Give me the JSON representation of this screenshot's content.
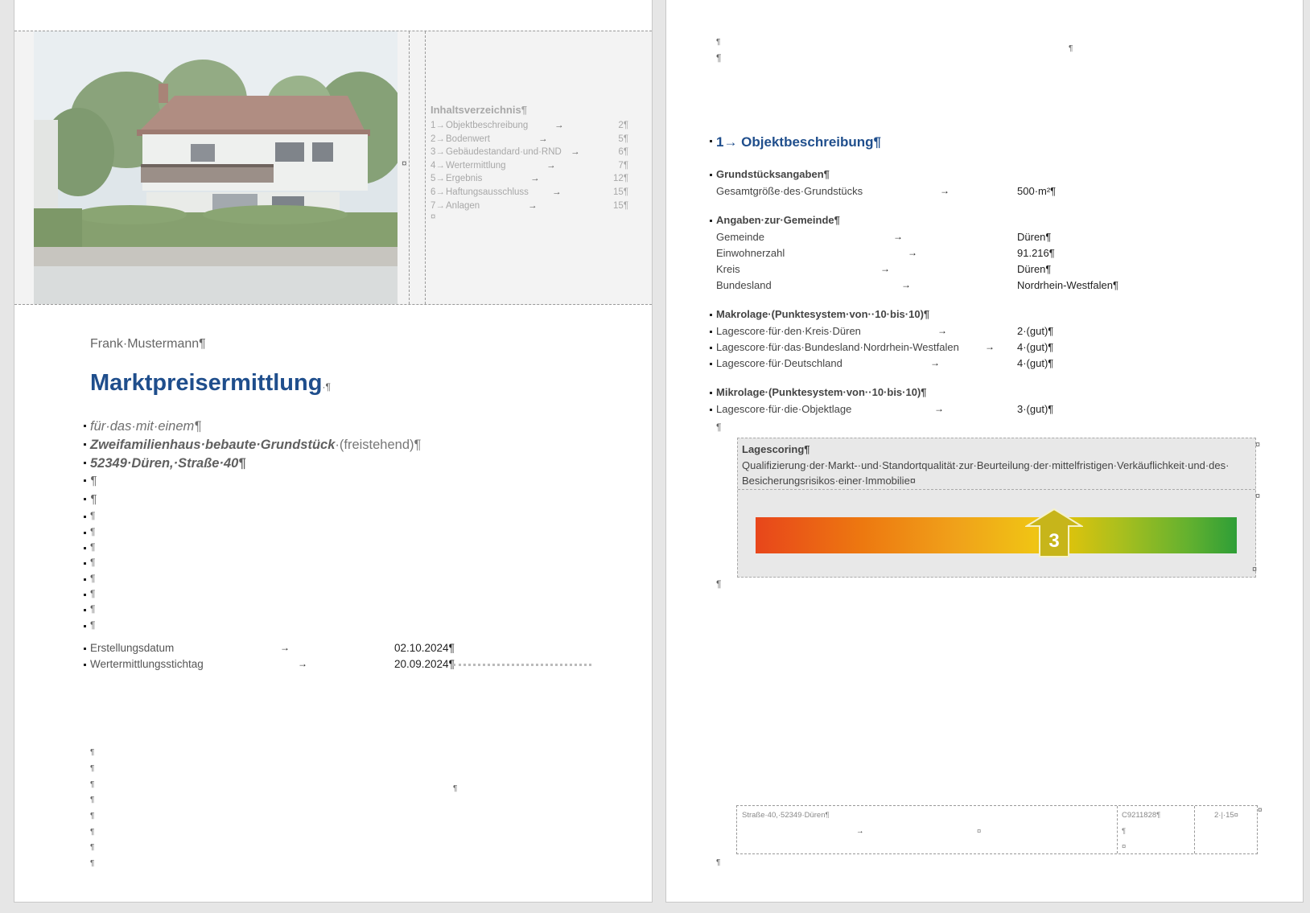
{
  "page1": {
    "toc": {
      "title": "Inhaltsverzeichnis¶",
      "items": [
        {
          "num": "1→",
          "label": "Objektbeschreibung",
          "page": "2¶"
        },
        {
          "num": "2→",
          "label": "Bodenwert",
          "page": "5¶"
        },
        {
          "num": "3→",
          "label": "Gebäudestandard·und·RND",
          "page": "6¶"
        },
        {
          "num": "4→",
          "label": "Wertermittlung",
          "page": "7¶"
        },
        {
          "num": "5→",
          "label": "Ergebnis",
          "page": "12¶"
        },
        {
          "num": "6→",
          "label": "Haftungsausschluss",
          "page": "15¶"
        },
        {
          "num": "7→",
          "label": "Anlagen",
          "page": "15¶"
        }
      ],
      "end_mark": "¤"
    },
    "author": "Frank·Mustermann¶",
    "title": "Marktpreisermittlung",
    "title_mark": "·¶",
    "subtitle_line1": "für·das·mit·einem¶",
    "subtitle_line2_bold": "Zweifamilienhaus·bebaute·Grundstück",
    "subtitle_line2_rest": "·(freistehend)¶",
    "address_line": "52349·Düren,·Straße·40¶",
    "pilcrow": "¶",
    "creation_label": "Erstellungsdatum",
    "creation_value": "02.10.2024¶",
    "valuation_label": "Wertermittlungsstichtag",
    "valuation_value": "20.09.2024¶",
    "tab_arrow": "→",
    "cell_mark": "¤"
  },
  "page2": {
    "heading": "1→ Objektbeschreibung¶",
    "grundstueck": {
      "title": "Grundstücksangaben¶",
      "rows": [
        {
          "label": "Gesamtgröße·des·Grundstücks",
          "value": "500·m²¶"
        }
      ]
    },
    "gemeinde": {
      "title": "Angaben·zur·Gemeinde¶",
      "rows": [
        {
          "label": "Gemeinde",
          "value": "Düren¶"
        },
        {
          "label": "Einwohnerzahl",
          "value": "91.216¶"
        },
        {
          "label": "Kreis",
          "value": "Düren¶"
        },
        {
          "label": "Bundesland",
          "value": "Nordrhein-Westfalen¶"
        }
      ]
    },
    "makrolage": {
      "title": "Makrolage·(Punktesystem·von··10·bis·10)¶",
      "rows": [
        {
          "label": "Lagescore·für·den·Kreis·Düren",
          "value": "2·(gut)¶"
        },
        {
          "label": "Lagescore·für·das·Bundesland·Nordrhein-Westfalen",
          "value": "4·(gut)¶"
        },
        {
          "label": "Lagescore·für·Deutschland",
          "value": "4·(gut)¶"
        }
      ]
    },
    "mikrolage": {
      "title": "Mikrolage·(Punktesystem·von··10·bis·10)¶",
      "rows": [
        {
          "label": "Lagescore·für·die·Objektlage",
          "value": "3·(gut)¶"
        }
      ]
    },
    "scoring": {
      "title": "Lagescoring¶",
      "desc_line1": "Qualifizierung·der·Markt-·und·Standortqualität·zur·Beurteilung·der·mittelfristigen·Verkäuflichkeit·und·des·",
      "desc_line2": "Besicherungsrisikos·einer·Immobilie¤",
      "score": "3",
      "score_fraction": 0.62
    },
    "footer": {
      "address": "Straße·40,·52349·Düren¶",
      "code": "C9211828¶",
      "page": "2·|·15¤",
      "tab_arrow": "→",
      "cell_mark": "¤",
      "pilcrow": "¶"
    },
    "pilcrow": "¶",
    "tab_arrow": "→",
    "cell_mark": "¤"
  },
  "colors": {
    "heading_blue": "#1f4e8c",
    "canvas": "#e6e6e6",
    "scoring_band": "#e8e8e8",
    "score_arrow": "#c7b51a"
  }
}
